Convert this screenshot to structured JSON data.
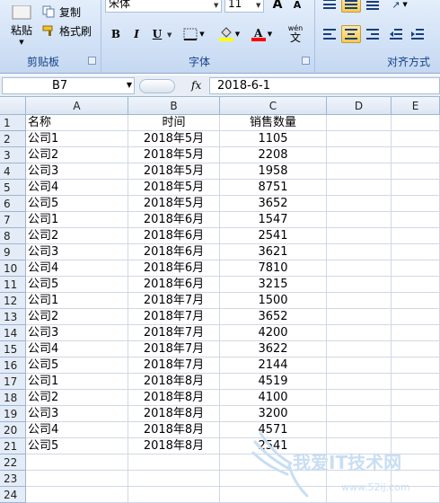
{
  "ribbon": {
    "clipboard": {
      "paste_label": "粘贴",
      "copy_label": "复制",
      "format_painter_label": "格式刷",
      "group_label": "剪贴板"
    },
    "font": {
      "font_name": "宋体",
      "font_size": "11",
      "bold": "B",
      "italic": "I",
      "underline": "U",
      "phonetic": "wén",
      "group_label": "字体",
      "fill_color": "#ffff00",
      "font_color": "#ff0000"
    },
    "alignment": {
      "group_label": "对齐方式"
    }
  },
  "formula_bar": {
    "name_box": "B7",
    "fx_label": "fx",
    "formula": "2018-6-1"
  },
  "sheet": {
    "columns": [
      "A",
      "B",
      "C",
      "D",
      "E"
    ],
    "header_row": {
      "a": "名称",
      "b": "时间",
      "c": "销售数量"
    },
    "rows": [
      {
        "a": "公司1",
        "b": "2018年5月",
        "c": "1105"
      },
      {
        "a": "公司2",
        "b": "2018年5月",
        "c": "2208"
      },
      {
        "a": "公司3",
        "b": "2018年5月",
        "c": "1958"
      },
      {
        "a": "公司4",
        "b": "2018年5月",
        "c": "8751"
      },
      {
        "a": "公司5",
        "b": "2018年5月",
        "c": "3652"
      },
      {
        "a": "公司1",
        "b": "2018年6月",
        "c": "1547"
      },
      {
        "a": "公司2",
        "b": "2018年6月",
        "c": "2541"
      },
      {
        "a": "公司3",
        "b": "2018年6月",
        "c": "3621"
      },
      {
        "a": "公司4",
        "b": "2018年6月",
        "c": "7810"
      },
      {
        "a": "公司5",
        "b": "2018年6月",
        "c": "3215"
      },
      {
        "a": "公司1",
        "b": "2018年7月",
        "c": "1500"
      },
      {
        "a": "公司2",
        "b": "2018年7月",
        "c": "3652"
      },
      {
        "a": "公司3",
        "b": "2018年7月",
        "c": "4200"
      },
      {
        "a": "公司4",
        "b": "2018年7月",
        "c": "3622"
      },
      {
        "a": "公司5",
        "b": "2018年7月",
        "c": "2144"
      },
      {
        "a": "公司1",
        "b": "2018年8月",
        "c": "4519"
      },
      {
        "a": "公司2",
        "b": "2018年8月",
        "c": "4100"
      },
      {
        "a": "公司3",
        "b": "2018年8月",
        "c": "3200"
      },
      {
        "a": "公司4",
        "b": "2018年8月",
        "c": "4571"
      },
      {
        "a": "公司5",
        "b": "2018年8月",
        "c": "2541"
      }
    ],
    "row_numbers": [
      "1",
      "2",
      "3",
      "4",
      "5",
      "6",
      "7",
      "8",
      "9",
      "10",
      "11",
      "12",
      "13",
      "14",
      "15",
      "16",
      "17",
      "18",
      "19",
      "20",
      "21",
      "22",
      "23",
      "24"
    ]
  },
  "watermark": {
    "text": "我爱IT技术网",
    "url": "www.52ij.com"
  }
}
